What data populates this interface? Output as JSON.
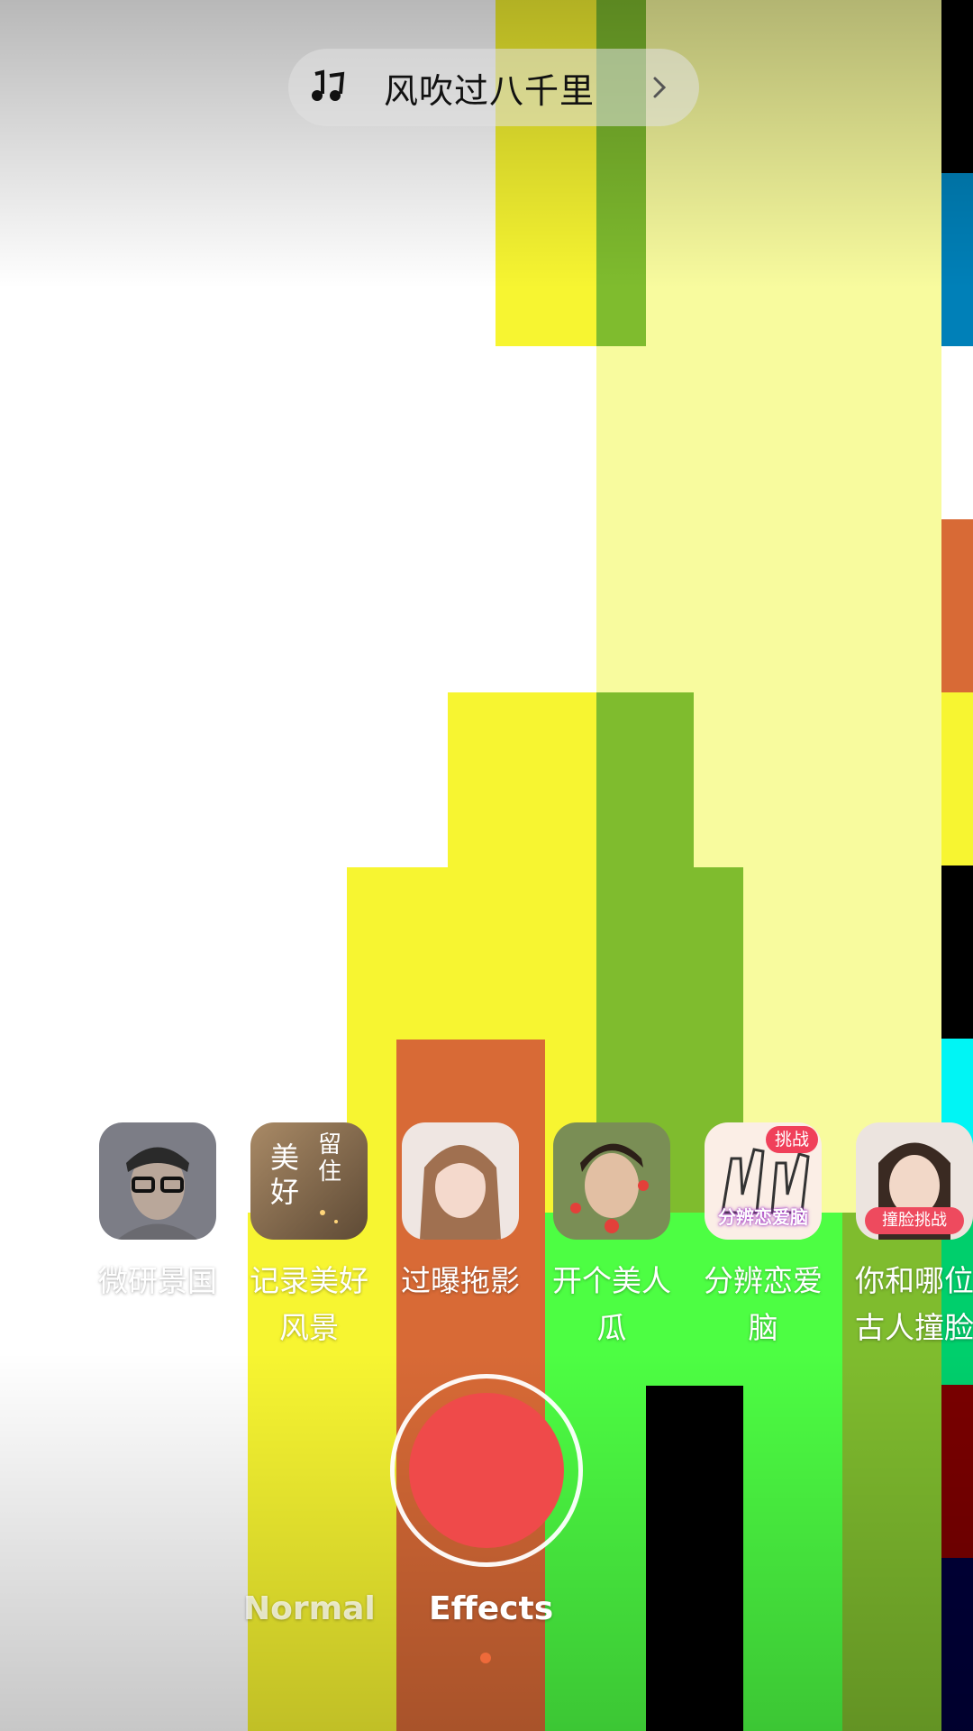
{
  "music": {
    "title": "风吹过八千里",
    "icon": "music-note-icon",
    "chevron": "chevron-right-icon"
  },
  "effects": [
    {
      "label_line1": "微研景国",
      "label_line2": "",
      "icon": "man-glasses-thumbnail"
    },
    {
      "label_line1": "记录美好",
      "label_line2": "风景",
      "icon": "text-thumbnail",
      "thumb_text_main": "美好",
      "thumb_text_side": "留住"
    },
    {
      "label_line1": "过曝拖影",
      "label_line2": "",
      "icon": "girl-thumbnail"
    },
    {
      "label_line1": "开个美人",
      "label_line2": "瓜",
      "icon": "boy-thumbnail"
    },
    {
      "label_line1": "分辨恋爱",
      "label_line2": "脑",
      "icon": "hands-thumbnail",
      "badge": "挑战",
      "caption": "分辨恋爱脑"
    },
    {
      "label_line1": "你和哪位",
      "label_line2": "古人撞脸",
      "icon": "woman-thumbnail",
      "caption": "撞脸挑战"
    }
  ],
  "modes": {
    "normal": "Normal",
    "effects": "Effects",
    "active": "effects"
  },
  "colors": {
    "record": "#ef4a4a",
    "active_dot": "#ee6a3a"
  }
}
